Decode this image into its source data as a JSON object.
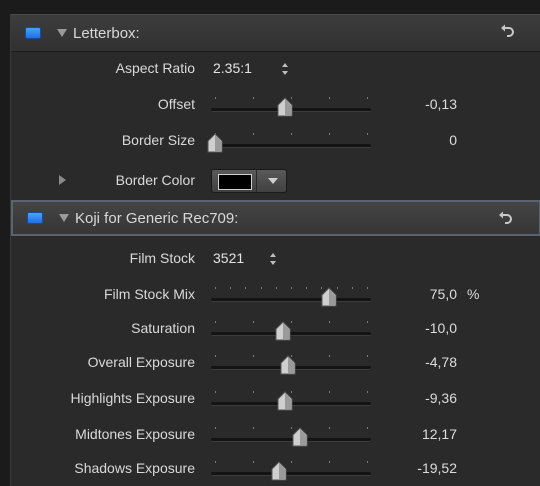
{
  "sections": [
    {
      "title": "Letterbox:",
      "enabled": true,
      "rows": [
        {
          "type": "popup",
          "label": "Aspect Ratio",
          "value": "2.35:1"
        },
        {
          "type": "slider",
          "label": "Offset",
          "value": "-0,13",
          "level": 0.46
        },
        {
          "type": "slider",
          "label": "Border Size",
          "value": "0",
          "level": 0.0
        },
        {
          "type": "color",
          "label": "Border Color",
          "color": "#000000"
        }
      ]
    },
    {
      "title": "Koji for Generic Rec709:",
      "enabled": true,
      "rows": [
        {
          "type": "popup",
          "label": "Film Stock",
          "value": "3521"
        },
        {
          "type": "slider",
          "label": "Film Stock Mix",
          "value": "75,0",
          "unit": "%",
          "level": 0.75
        },
        {
          "type": "slider",
          "label": "Saturation",
          "value": "-10,0",
          "level": 0.45
        },
        {
          "type": "slider",
          "label": "Overall Exposure",
          "value": "-4,78",
          "level": 0.48
        },
        {
          "type": "slider",
          "label": "Highlights Exposure",
          "value": "-9,36",
          "level": 0.46
        },
        {
          "type": "slider",
          "label": "Midtones Exposure",
          "value": "12,17",
          "level": 0.56
        },
        {
          "type": "slider",
          "label": "Shadows Exposure",
          "value": "-19,52",
          "level": 0.42
        }
      ]
    }
  ],
  "colors": {
    "checkbox": "#2f86f0",
    "panel": "#2a2a2a"
  }
}
